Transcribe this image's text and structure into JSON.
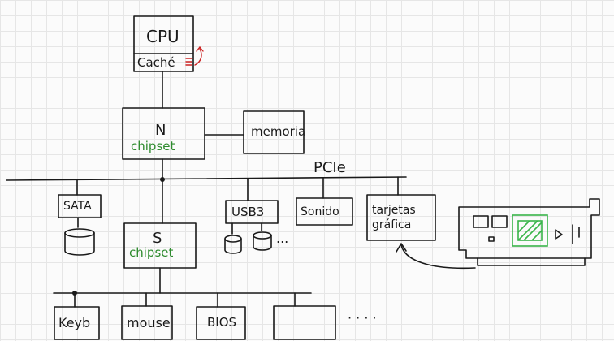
{
  "diagram": {
    "cpu": {
      "title": "CPU",
      "cache": "Caché"
    },
    "north_bridge": {
      "title": "N",
      "subtitle": "chipset"
    },
    "memory": "memoria",
    "pcie_bus": "PCIe",
    "sata": "SATA",
    "south_bridge": {
      "title": "S",
      "subtitle": "chipset"
    },
    "usb3": "USB3",
    "usb_more": "...",
    "sound": "Sonido",
    "graphics": "tarjetas gráfica",
    "bottom_devices": [
      "Keyb",
      "mouse",
      "BIOS",
      ""
    ],
    "bottom_more": "· · · ·",
    "colors": {
      "ink": "#1a1a1a",
      "chipset": "#2e8b2e",
      "cache_arrow": "#cc2222",
      "gpu_chip": "#39b54a"
    }
  }
}
